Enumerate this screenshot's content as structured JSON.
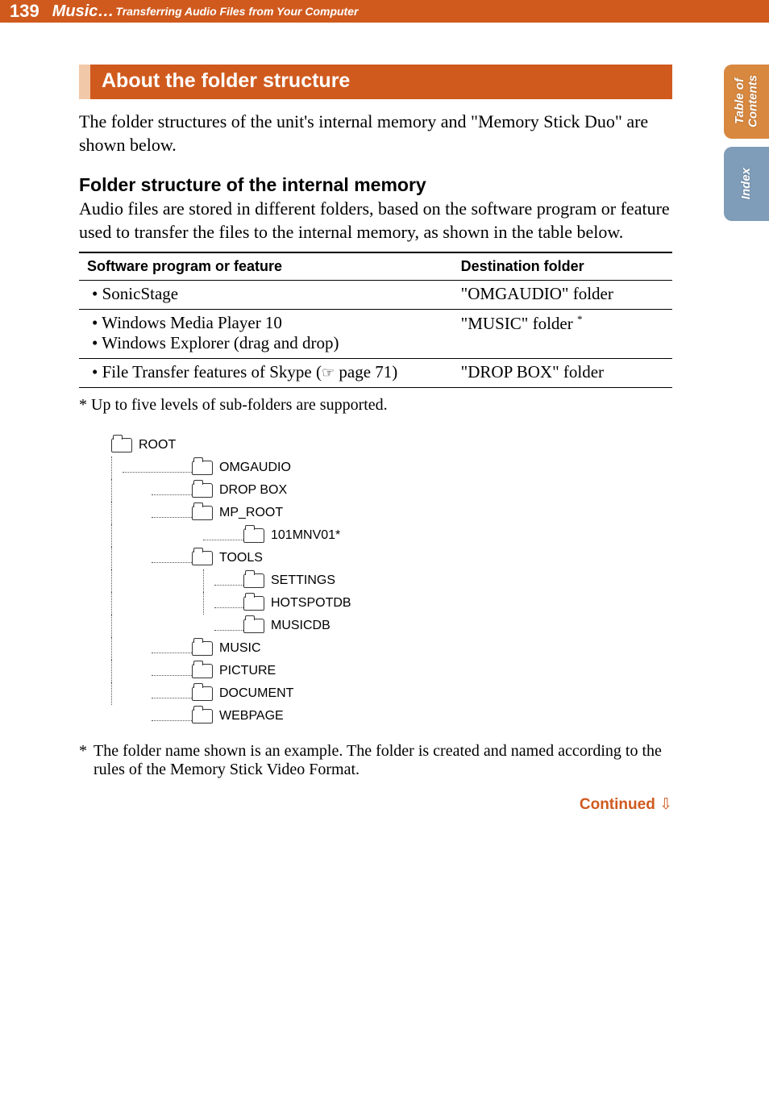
{
  "header": {
    "page_number": "139",
    "crumb_main": "Music…",
    "crumb_sub": "Transferring Audio Files from Your Computer"
  },
  "side_tabs": {
    "toc": "Table of\nContents",
    "index": "Index"
  },
  "section": {
    "h1": "About the folder structure",
    "intro": "The folder structures of the unit's internal memory and \"Memory Stick Duo\" are shown below.",
    "h2": "Folder structure of the internal memory",
    "p2": "Audio files are stored in different folders, based on the software program or feature used to transfer the files to the internal memory, as shown in the table below."
  },
  "table": {
    "col1": "Software program or feature",
    "col2": "Destination folder",
    "rows": [
      {
        "left": [
          "SonicStage"
        ],
        "right": "\"OMGAUDIO\" folder",
        "right_sup": ""
      },
      {
        "left": [
          "Windows Media Player 10",
          "Windows Explorer (drag and drop)"
        ],
        "right": "\"MUSIC\" folder ",
        "right_sup": "*"
      },
      {
        "left_prefix": "File Transfer features of Skype (",
        "left_xref": "☞",
        "left_suffix": " page 71)",
        "right": "\"DROP BOX\" folder",
        "right_sup": ""
      }
    ]
  },
  "footnotes": {
    "f1": "* Up to five levels of sub-folders are supported.",
    "f2": "The folder name shown is an example. The folder is created and named according to the rules of the Memory Stick Video Format."
  },
  "tree": {
    "root": "ROOT",
    "omgaudio": "OMGAUDIO",
    "dropbox": "DROP BOX",
    "mproot": "MP_ROOT",
    "v101": "101MNV01*",
    "tools": "TOOLS",
    "settings": "SETTINGS",
    "hotspotdb": "HOTSPOTDB",
    "musicdb": "MUSICDB",
    "music": "MUSIC",
    "picture": "PICTURE",
    "document": "DOCUMENT",
    "webpage": "WEBPAGE"
  },
  "continued": "Continued "
}
